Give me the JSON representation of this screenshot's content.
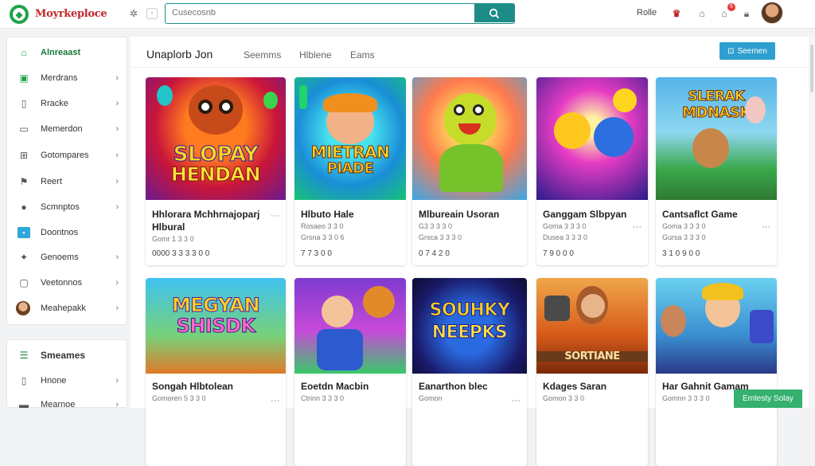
{
  "header": {
    "brand": "Moyrkeploce",
    "search_placeholder": "Cusecosnb",
    "right_label": "Rolle",
    "notification_count": "6"
  },
  "sidebar": {
    "items": [
      {
        "label": "Alnreaast",
        "icon": "home-icon",
        "active": true
      },
      {
        "label": "Merdrans",
        "icon": "gamepad-icon"
      },
      {
        "label": "Rracke",
        "icon": "bookmark-icon"
      },
      {
        "label": "Memerdon",
        "icon": "chat-icon"
      },
      {
        "label": "Gotompares",
        "icon": "grid-icon"
      },
      {
        "label": "Reert",
        "icon": "flag-icon"
      },
      {
        "label": "Scmnptos",
        "icon": "user-icon"
      },
      {
        "label": "Doontnos",
        "icon": "image-icon"
      },
      {
        "label": "Genoems",
        "icon": "puzzle-icon"
      },
      {
        "label": "Veetonnos",
        "icon": "shield-icon"
      },
      {
        "label": "Meahepakk",
        "icon": "avatar-icon"
      }
    ],
    "section2_title": "Smeames",
    "section2_items": [
      {
        "label": "Hnone",
        "icon": "card-icon"
      },
      {
        "label": "Mearnoe",
        "icon": "tag-icon"
      }
    ]
  },
  "main": {
    "title": "Unaplorb   Jon",
    "tabs": [
      "Seemms",
      "Hlblene",
      "Eams"
    ],
    "action_label": "Seemen"
  },
  "cards": [
    {
      "title": "Hhlorara Mchhrnajoparj Hlbural",
      "meta": "Gomr 1 3 3 0",
      "price": "0000 3 3 3 3 0 0",
      "thumb_line1": "SLOPAY",
      "thumb_line2": "HENDAN"
    },
    {
      "title": "Hlbuto Hale",
      "meta": "Rosaeo 3 3 0",
      "meta2": "Grsna 3 3 0 6",
      "price": "7 7 3 0 0",
      "thumb_line1": "MIETRAN",
      "thumb_line2": "PIADE"
    },
    {
      "title": "Mlbureain Usoran",
      "meta": "G3 3 3 3 0",
      "meta2": "Grsca 3 3 3 0",
      "price": "0 7 4 2 0",
      "thumb_line1": "",
      "thumb_line2": ""
    },
    {
      "title": "Ganggam Slbpyan",
      "meta": "Goma 3 3 3 0",
      "meta2": "Dusea 3 3 3 0",
      "price": "7 9 0 0 0",
      "thumb_line1": "",
      "thumb_line2": ""
    },
    {
      "title": "Cantsaflct Game",
      "meta": "Goma 3 3 3 0",
      "meta2": "Gursa 3 3 3 0",
      "price": "3 1 0 9 0 0",
      "thumb_line1": "SLERAK",
      "thumb_line2": "MDNASK"
    },
    {
      "title": "Songah Hlbtolean",
      "meta": "Gomoren 5 3 3 0",
      "thumb_line1": "MEGYAN",
      "thumb_line2": "SHISDK"
    },
    {
      "title": "Eoetdn Macbin",
      "meta": "Ctrinn 3 3 3 0",
      "thumb_line1": "",
      "thumb_line2": ""
    },
    {
      "title": "Eanarthon blec",
      "meta": "Gomon",
      "thumb_line1": "SOUHKY",
      "thumb_line2": "NEEPKS"
    },
    {
      "title": "Kdages Saran",
      "meta": "Gomon 3 3 0",
      "thumb_line1": "SORTIANE",
      "thumb_line2": ""
    },
    {
      "title": "Har Gahnit Gamam",
      "meta": "Gomnn 3 3 3 0",
      "thumb_line1": "",
      "thumb_line2": ""
    }
  ],
  "footer": {
    "button_label": "Emtesty Solay"
  }
}
